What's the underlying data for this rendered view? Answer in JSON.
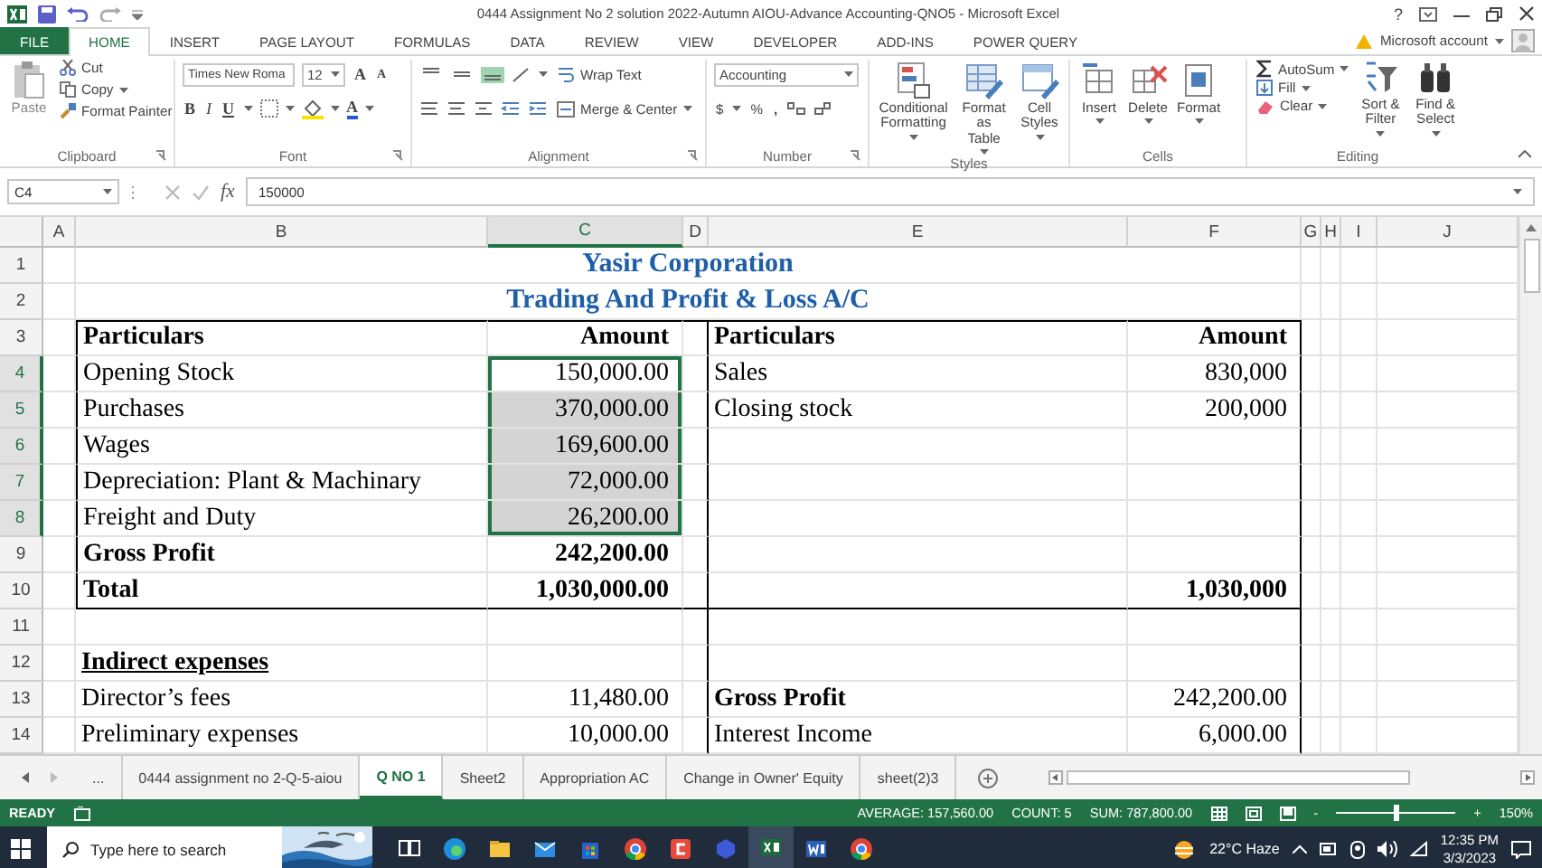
{
  "window": {
    "title": "0444 Assignment No 2 solution 2022-Autumn AIOU-Advance Accounting-QNO5 - Microsoft Excel",
    "help": "?"
  },
  "file_tab": "FILE",
  "ribbon_tabs": [
    {
      "label": "HOME",
      "selected": true
    },
    {
      "label": "INSERT",
      "selected": false
    },
    {
      "label": "PAGE LAYOUT",
      "selected": false
    },
    {
      "label": "FORMULAS",
      "selected": false
    },
    {
      "label": "DATA",
      "selected": false
    },
    {
      "label": "REVIEW",
      "selected": false
    },
    {
      "label": "VIEW",
      "selected": false
    },
    {
      "label": "DEVELOPER",
      "selected": false
    },
    {
      "label": "ADD-INS",
      "selected": false
    },
    {
      "label": "POWER QUERY",
      "selected": false
    }
  ],
  "account": "Microsoft account",
  "ribbon": {
    "clipboard": {
      "label": "Clipboard",
      "paste": "Paste",
      "cut": "Cut",
      "copy": "Copy",
      "format_painter": "Format Painter"
    },
    "font": {
      "label": "Font",
      "name": "Times New Roma",
      "size": "12",
      "grow": "A",
      "shrink": "A",
      "bold": "B",
      "italic": "I",
      "underline": "U",
      "font_color_button": "A"
    },
    "alignment": {
      "label": "Alignment",
      "vertical": [
        {
          "selected": false
        },
        {
          "selected": false
        },
        {
          "selected": true
        }
      ],
      "wrap": "Wrap Text",
      "merge": "Merge & Center"
    },
    "number": {
      "label": "Number",
      "format": "Accounting",
      "currency": "$",
      "percent": "%",
      "comma": ","
    },
    "styles": {
      "label": "Styles",
      "buttons": [
        "Conditional Formatting",
        "Format as Table",
        "Cell Styles"
      ]
    },
    "cells": {
      "label": "Cells",
      "buttons": [
        "Insert",
        "Delete",
        "Format"
      ]
    },
    "editing": {
      "label": "Editing",
      "autosum": "AutoSum",
      "fill": "Fill",
      "clear": "Clear",
      "sort": "Sort & Filter",
      "find": "Find & Select"
    }
  },
  "formula_bar": {
    "name_box": "C4",
    "fx": "fx",
    "value": "150000"
  },
  "columns": [
    {
      "label": "A",
      "selected": false
    },
    {
      "label": "B",
      "selected": false
    },
    {
      "label": "C",
      "selected": true
    },
    {
      "label": "D",
      "selected": false
    },
    {
      "label": "E",
      "selected": false
    },
    {
      "label": "F",
      "selected": false
    },
    {
      "label": "G",
      "selected": false
    },
    {
      "label": "H",
      "selected": false
    },
    {
      "label": "I",
      "selected": false
    },
    {
      "label": "J",
      "selected": false
    }
  ],
  "rows": [
    {
      "number": "1",
      "kind": "title",
      "selected": false,
      "text": "Yasir Corporation"
    },
    {
      "number": "2",
      "kind": "title",
      "selected": false,
      "text": "Trading And Profit & Loss A/C"
    },
    {
      "number": "3",
      "kind": "table",
      "selected": false,
      "b": {
        "text": "Particulars",
        "bold": true,
        "underline": false
      },
      "c": {
        "text": "Amount",
        "bold": true,
        "underline": false
      },
      "e": {
        "text": "Particulars",
        "bold": true,
        "underline": false
      },
      "f": {
        "text": "Amount",
        "bold": true,
        "underline": false
      }
    },
    {
      "number": "4",
      "kind": "table",
      "selected": true,
      "b": {
        "text": "Opening Stock",
        "bold": false,
        "underline": false
      },
      "c": {
        "text": "150,000.00",
        "bold": false,
        "underline": false
      },
      "e": {
        "text": "Sales",
        "bold": false,
        "underline": false
      },
      "f": {
        "text": "830,000",
        "bold": false,
        "underline": false
      }
    },
    {
      "number": "5",
      "kind": "table",
      "selected": true,
      "b": {
        "text": "Purchases",
        "bold": false,
        "underline": false
      },
      "c": {
        "text": "370,000.00",
        "bold": false,
        "underline": false
      },
      "e": {
        "text": "Closing stock",
        "bold": false,
        "underline": false
      },
      "f": {
        "text": "200,000",
        "bold": false,
        "underline": false
      }
    },
    {
      "number": "6",
      "kind": "table",
      "selected": true,
      "b": {
        "text": "Wages",
        "bold": false,
        "underline": false
      },
      "c": {
        "text": "169,600.00",
        "bold": false,
        "underline": false
      }
    },
    {
      "number": "7",
      "kind": "table",
      "selected": true,
      "b": {
        "text": "Depreciation: Plant & Machinary",
        "bold": false,
        "underline": false
      },
      "c": {
        "text": "72,000.00",
        "bold": false,
        "underline": false
      }
    },
    {
      "number": "8",
      "kind": "table",
      "selected": true,
      "b": {
        "text": "Freight and Duty",
        "bold": false,
        "underline": false
      },
      "c": {
        "text": "26,200.00",
        "bold": false,
        "underline": false
      }
    },
    {
      "number": "9",
      "kind": "table",
      "selected": false,
      "b": {
        "text": "Gross Profit",
        "bold": true,
        "underline": false
      },
      "c": {
        "text": "242,200.00",
        "bold": true,
        "underline": false
      }
    },
    {
      "number": "10",
      "kind": "table",
      "selected": false,
      "b": {
        "text": "Total",
        "bold": true,
        "underline": false
      },
      "c": {
        "text": "1,030,000.00",
        "bold": true,
        "underline": false
      },
      "f": {
        "text": "1,030,000",
        "bold": true,
        "underline": false
      }
    },
    {
      "number": "11",
      "kind": "ledger",
      "selected": false
    },
    {
      "number": "12",
      "kind": "ledger",
      "selected": false,
      "b": {
        "text": "Indirect expenses",
        "bold": true,
        "underline": true
      }
    },
    {
      "number": "13",
      "kind": "ledger",
      "selected": false,
      "b": {
        "text": "Director’s fees",
        "bold": false,
        "underline": false
      },
      "c": {
        "text": "11,480.00",
        "bold": false,
        "underline": false
      },
      "e": {
        "text": "Gross Profit",
        "bold": true,
        "underline": false
      },
      "f": {
        "text": "242,200.00",
        "bold": false,
        "underline": false
      }
    },
    {
      "number": "14",
      "kind": "ledger",
      "selected": false,
      "b": {
        "text": "Preliminary expenses",
        "bold": false,
        "underline": false
      },
      "c": {
        "text": "10,000.00",
        "bold": false,
        "underline": false
      },
      "e": {
        "text": "Interest Income",
        "bold": false,
        "underline": false
      },
      "f": {
        "text": "6,000.00",
        "bold": false,
        "underline": false
      }
    }
  ],
  "sheet_tabs": [
    {
      "label": "...",
      "selected": false
    },
    {
      "label": "0444 assignment no 2-Q-5-aiou",
      "selected": false
    },
    {
      "label": "Q NO 1",
      "selected": true
    },
    {
      "label": "Sheet2",
      "selected": false
    },
    {
      "label": "Appropriation AC",
      "selected": false
    },
    {
      "label": "Change in Owner' Equity",
      "selected": false
    },
    {
      "label": "sheet(2)3",
      "selected": false
    }
  ],
  "status_bar": {
    "mode": "READY",
    "average": "AVERAGE: 157,560.00",
    "count": "COUNT: 5",
    "sum": "SUM: 787,800.00",
    "zoom_out": "-",
    "zoom_in": "+",
    "zoom_slider": {
      "level": 0.5
    },
    "zoom": "150%"
  },
  "taskbar": {
    "search": {
      "placeholder": "Type here to search"
    },
    "apps": [
      {
        "kind": "taskview",
        "selected": false
      },
      {
        "kind": "edge",
        "selected": false
      },
      {
        "kind": "folder",
        "selected": false
      },
      {
        "kind": "mail",
        "selected": false
      },
      {
        "kind": "store",
        "selected": false
      },
      {
        "kind": "chrome",
        "selected": false
      },
      {
        "kind": "redapp",
        "selected": false
      },
      {
        "kind": "blueapp",
        "selected": false
      },
      {
        "kind": "excel",
        "selected": true
      },
      {
        "kind": "word",
        "selected": false
      },
      {
        "kind": "chrome",
        "selected": false
      }
    ],
    "weather": "22°C  Haze",
    "time": "12:35 PM",
    "date": "3/3/2023"
  }
}
